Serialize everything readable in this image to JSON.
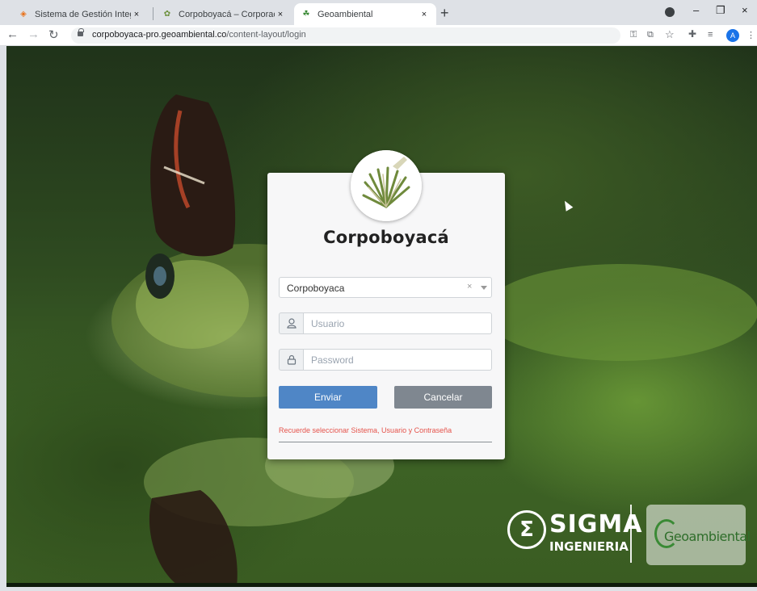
{
  "browser": {
    "tabs": [
      {
        "title": "Sistema de Gestión Integral",
        "icon": "flame-favicon-icon"
      },
      {
        "title": "Corpoboyacá – Corporación Autó",
        "icon": "plant-favicon-icon"
      },
      {
        "title": "Geoambiental",
        "icon": "geoambiental-favicon-icon"
      }
    ],
    "new_tab_label": "+",
    "close_tab_label": "×",
    "window_controls": {
      "minimize": "–",
      "restore": "❐",
      "close": "×"
    },
    "url_host": "corpoboyaca-pro.geoambiental.co",
    "url_path": "/content-layout/login",
    "profile_initial": "A"
  },
  "login": {
    "brand": "Corpoboyacá",
    "system_select": {
      "selected": "Corpoboyaca",
      "clear_label": "×"
    },
    "username": {
      "placeholder": "Usuario",
      "value": ""
    },
    "password": {
      "placeholder": "Password",
      "value": ""
    },
    "submit_label": "Enviar",
    "cancel_label": "Cancelar",
    "hint": "Recuerde seleccionar Sistema, Usuario y Contraseña"
  },
  "footer": {
    "sigma_symbol": "Σ",
    "sigma_title": "SIGMA",
    "sigma_subtitle": "INGENIERIA",
    "geo_text": "Geoambiental"
  },
  "colors": {
    "primary_button": "#4f86c6",
    "cancel_button": "#7f8790",
    "hint": "#e5534b",
    "profile": "#1a73e8"
  }
}
